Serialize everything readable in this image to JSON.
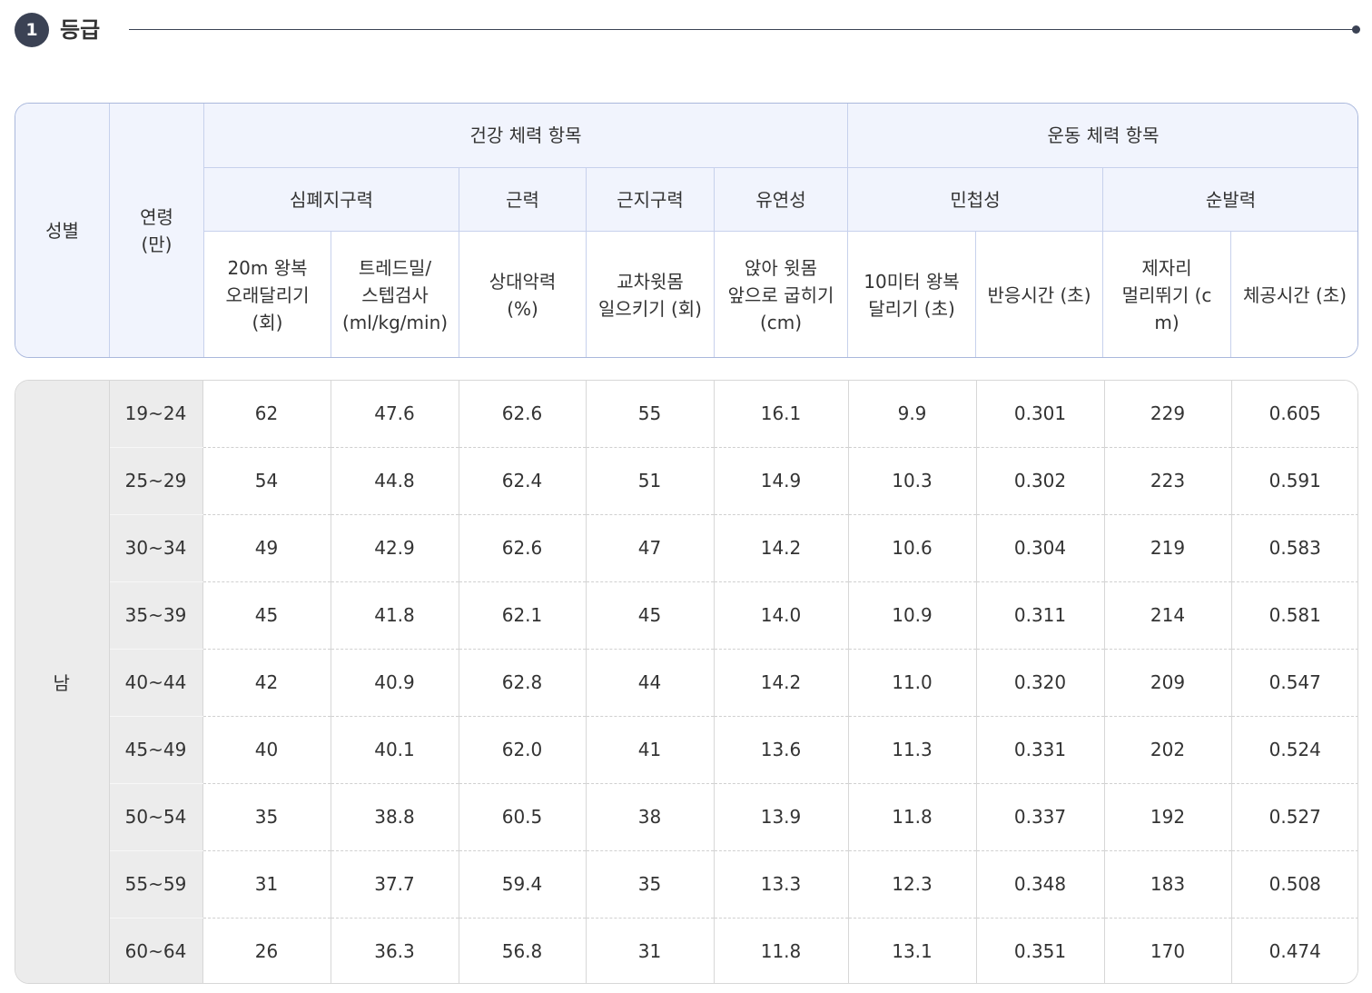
{
  "section": {
    "number": "1",
    "title": "등급"
  },
  "header": {
    "gender": "성별",
    "age_line1": "연령",
    "age_line2": "(만)",
    "group_health": "건강 체력 항목",
    "group_sport": "운동 체력 항목",
    "sub_cardio": "심폐지구력",
    "sub_strength": "근력",
    "sub_endurance": "근지구력",
    "sub_flex": "유연성",
    "sub_agility": "민첩성",
    "sub_power": "순발력",
    "columns": [
      {
        "line1": "20m 왕복",
        "line2": "오래달리기",
        "line3": "(회)"
      },
      {
        "line1": "트레드밀/",
        "line2": "스텝검사",
        "line3": "(ml/kg/min)"
      },
      {
        "line1": "상대악력",
        "line2": "(%)",
        "line3": ""
      },
      {
        "line1": "교차윗몸",
        "line2": "일으키기 (회)",
        "line3": ""
      },
      {
        "line1": "앉아 윗몸",
        "line2": "앞으로 굽히기",
        "line3": "(cm)"
      },
      {
        "line1": "10미터 왕복",
        "line2": "달리기 (초)",
        "line3": ""
      },
      {
        "line1": "반응시간 (초)",
        "line2": "",
        "line3": ""
      },
      {
        "line1": "제자리",
        "line2": "멀리뛰기 (c",
        "line3": "m)"
      },
      {
        "line1": "체공시간 (초)",
        "line2": "",
        "line3": ""
      }
    ]
  },
  "body": {
    "gender": "남",
    "rows": [
      {
        "age": "19~24",
        "values": [
          "62",
          "47.6",
          "62.6",
          "55",
          "16.1",
          "9.9",
          "0.301",
          "229",
          "0.605"
        ]
      },
      {
        "age": "25~29",
        "values": [
          "54",
          "44.8",
          "62.4",
          "51",
          "14.9",
          "10.3",
          "0.302",
          "223",
          "0.591"
        ]
      },
      {
        "age": "30~34",
        "values": [
          "49",
          "42.9",
          "62.6",
          "47",
          "14.2",
          "10.6",
          "0.304",
          "219",
          "0.583"
        ]
      },
      {
        "age": "35~39",
        "values": [
          "45",
          "41.8",
          "62.1",
          "45",
          "14.0",
          "10.9",
          "0.311",
          "214",
          "0.581"
        ]
      },
      {
        "age": "40~44",
        "values": [
          "42",
          "40.9",
          "62.8",
          "44",
          "14.2",
          "11.0",
          "0.320",
          "209",
          "0.547"
        ]
      },
      {
        "age": "45~49",
        "values": [
          "40",
          "40.1",
          "62.0",
          "41",
          "13.6",
          "11.3",
          "0.331",
          "202",
          "0.524"
        ]
      },
      {
        "age": "50~54",
        "values": [
          "35",
          "38.8",
          "60.5",
          "38",
          "13.9",
          "11.8",
          "0.337",
          "192",
          "0.527"
        ]
      },
      {
        "age": "55~59",
        "values": [
          "31",
          "37.7",
          "59.4",
          "35",
          "13.3",
          "12.3",
          "0.348",
          "183",
          "0.508"
        ]
      },
      {
        "age": "60~64",
        "values": [
          "26",
          "36.3",
          "56.8",
          "31",
          "11.8",
          "13.1",
          "0.351",
          "170",
          "0.474"
        ]
      }
    ]
  }
}
